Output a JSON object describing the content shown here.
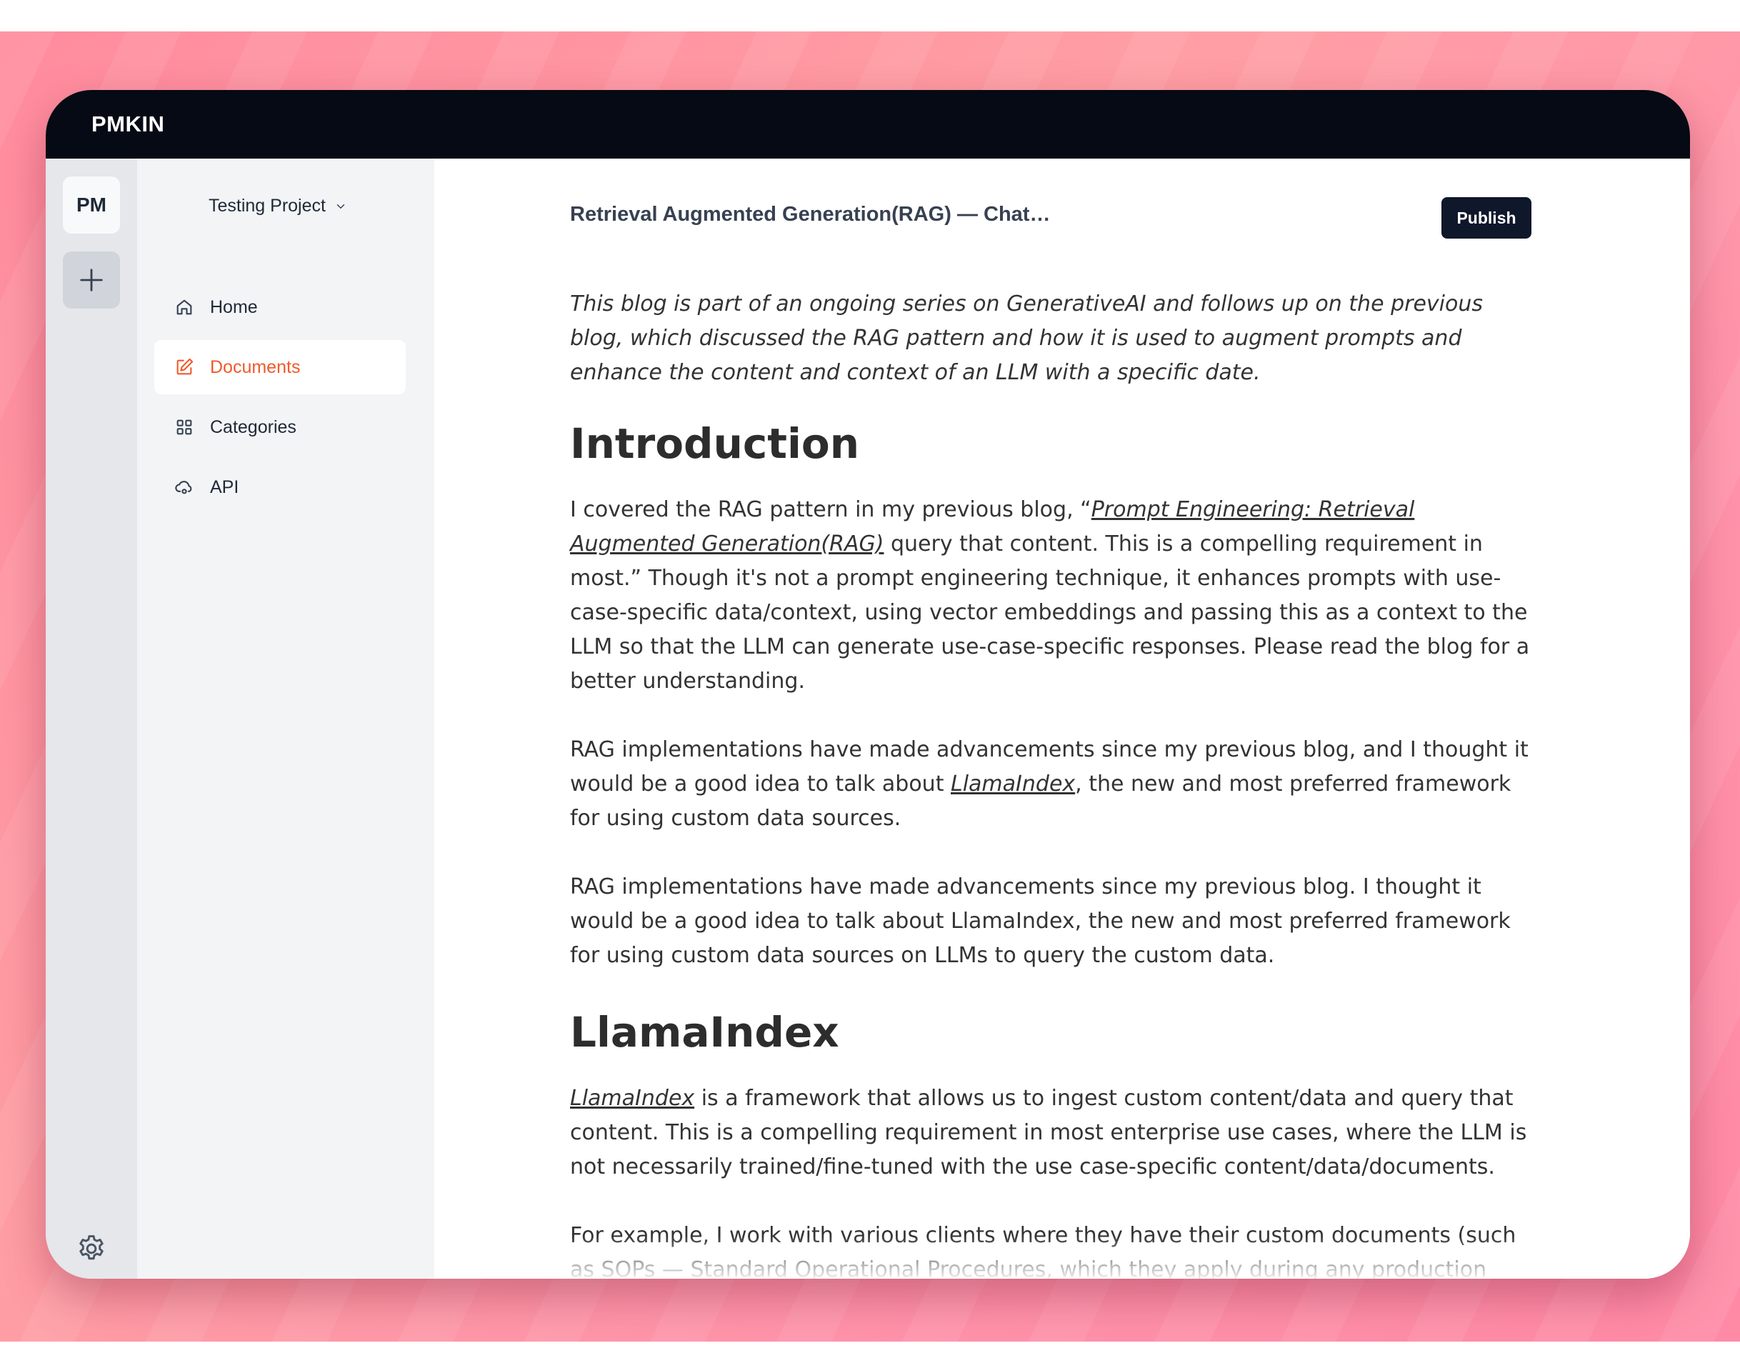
{
  "app": {
    "brand": "PMKIN"
  },
  "rail": {
    "avatar_initials": "PM",
    "add_icon": "plus-icon",
    "settings_icon": "gear-icon"
  },
  "sidebar": {
    "project_name": "Testing Project",
    "items": [
      {
        "label": "Home",
        "icon": "home-icon",
        "active": false
      },
      {
        "label": "Documents",
        "icon": "edit-icon",
        "active": true
      },
      {
        "label": "Categories",
        "icon": "grid-icon",
        "active": false
      },
      {
        "label": "API",
        "icon": "cloud-icon",
        "active": false
      }
    ]
  },
  "document": {
    "title": "Retrieval Augmented Generation(RAG) — Chat…",
    "publish_label": "Publish",
    "intro_italic": "This blog is part of an ongoing series on GenerativeAI and follows up on the previous blog, which discussed the RAG pattern and how it is used to augment prompts and enhance the content and context of an LLM with a specific date.",
    "heading_1": "Introduction",
    "p1_a": "I covered the RAG pattern in my previous blog, “",
    "p1_link": "Prompt Engineering: Retrieval Augmented Generation(RAG)",
    "p1_b": " query that content. This is a compelling requirement in most.” Though it's not a prompt engineering technique, it enhances prompts with use-case-specific data/context, using vector embeddings and passing this as a context to the LLM so that the LLM can generate use-case-specific responses. Please read the blog for a better understanding.",
    "p2_a": "RAG implementations have made advancements since my previous blog, and I thought it would be a good idea to talk about ",
    "p2_link": "LlamaIndex",
    "p2_b": ", the new and most preferred framework for using custom data sources.",
    "p3": "RAG implementations have made advancements since my previous blog. I thought it would be a good idea to talk about LlamaIndex, the new and most preferred framework for using custom data sources on LLMs to query the custom data.",
    "heading_2": "LlamaIndex",
    "p4_link": "LlamaIndex",
    "p4_b": " is a framework that allows us to ingest custom content/data and query that content. This is a compelling requirement in most enterprise use cases, where the LLM is not necessarily trained/fine-tuned with the use case-specific content/data/documents.",
    "p5": "For example, I work with various clients where they have their custom documents (such as SOPs — Standard Operational Procedures, which they apply during any production incidents/tickets/events. In such cases, it is so easy to ingest the terabytes of Word documents"
  },
  "colors": {
    "accent": "#f05a28",
    "topbar": "#050a14",
    "publish_bg": "#0f172a"
  }
}
